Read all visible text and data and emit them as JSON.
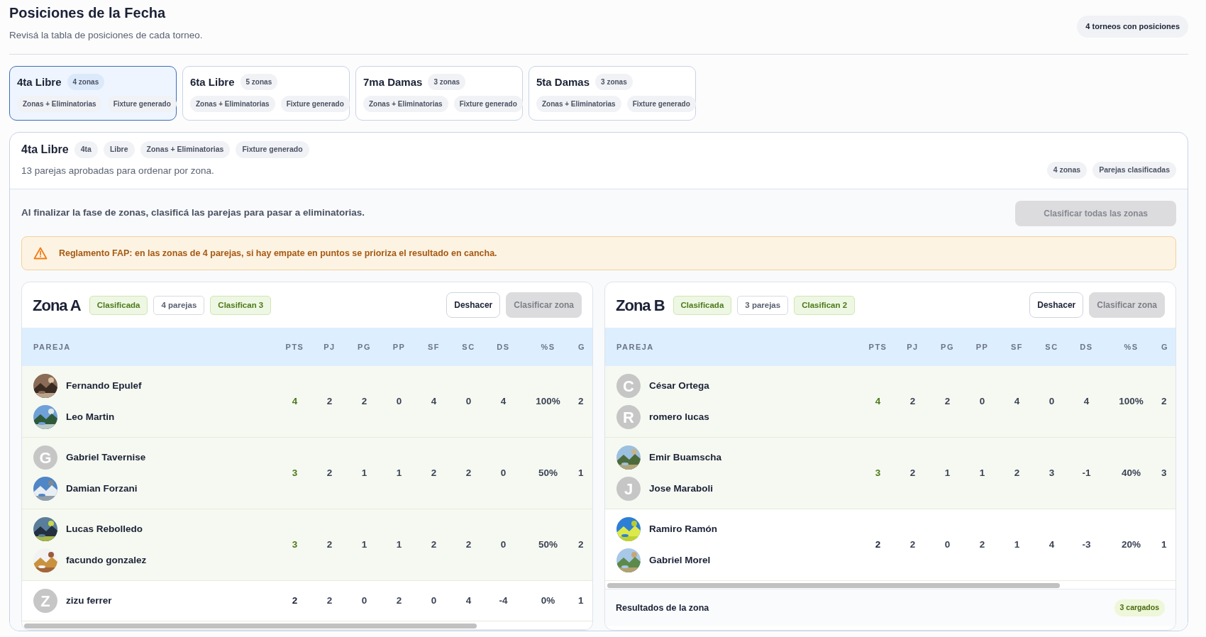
{
  "page": {
    "title": "Posiciones de la Fecha",
    "subtitle": "Revisá la tabla de posiciones de cada torneo.",
    "count_badge": "4 torneos con posiciones"
  },
  "tournaments": [
    {
      "name": "4ta Libre",
      "zones": "4 zonas",
      "tags": [
        "Zonas + Eliminatorias",
        "Fixture generado"
      ],
      "selected": true
    },
    {
      "name": "6ta Libre",
      "zones": "5 zonas",
      "tags": [
        "Zonas + Eliminatorias",
        "Fixture generado"
      ],
      "selected": false
    },
    {
      "name": "7ma Damas",
      "zones": "3 zonas",
      "tags": [
        "Zonas + Eliminatorias",
        "Fixture generado"
      ],
      "selected": false
    },
    {
      "name": "5ta Damas",
      "zones": "3 zonas",
      "tags": [
        "Zonas + Eliminatorias",
        "Fixture generado"
      ],
      "selected": false
    }
  ],
  "detail": {
    "title": "4ta Libre",
    "tags": [
      "4ta",
      "Libre",
      "Zonas + Eliminatorias",
      "Fixture generado"
    ],
    "subtitle": "13 parejas aprobadas para ordenar por zona.",
    "badges": [
      "4 zonas",
      "Parejas clasificadas"
    ],
    "instruction": "Al finalizar la fase de zonas, clasificá las parejas para pasar a eliminatorias.",
    "classify_all": {
      "label": "Clasificar todas las zonas",
      "disabled": true
    },
    "alert": "Reglamento FAP: en las zonas de 4 parejas, si hay empate en puntos se prioriza el resultado en cancha."
  },
  "zones": [
    {
      "name": "Zona A",
      "badges": [
        {
          "text": "Clasificada",
          "kind": "success"
        },
        {
          "text": "4 parejas",
          "kind": "neutral"
        },
        {
          "text": "Clasifican 3",
          "kind": "success"
        }
      ],
      "buttons": [
        {
          "label": "Deshacer",
          "disabled": false
        },
        {
          "label": "Clasificar zona",
          "disabled": true
        }
      ],
      "columns": [
        "PAREJA",
        "PTS",
        "PJ",
        "PG",
        "PP",
        "SF",
        "SC",
        "DS",
        "%S",
        "G"
      ],
      "rows": [
        {
          "qualified": true,
          "players": [
            {
              "name": "Fernando Epulef"
            },
            {
              "name": "Leo Martin"
            }
          ],
          "stats": [
            "4",
            "2",
            "2",
            "0",
            "4",
            "0",
            "4",
            "100%",
            "2"
          ]
        },
        {
          "qualified": true,
          "players": [
            {
              "name": "Gabriel Tavernise",
              "avatar": {
                "kind": "letter",
                "letter": "G"
              }
            },
            {
              "name": "Damian Forzani"
            }
          ],
          "stats": [
            "3",
            "2",
            "1",
            "1",
            "2",
            "2",
            "0",
            "50%",
            "1"
          ]
        },
        {
          "qualified": true,
          "players": [
            {
              "name": "Lucas Rebolledo"
            },
            {
              "name": "facundo gonzalez"
            }
          ],
          "stats": [
            "3",
            "2",
            "1",
            "1",
            "2",
            "2",
            "0",
            "50%",
            "2"
          ]
        },
        {
          "qualified": false,
          "players": [
            {
              "name": "zizu ferrer",
              "avatar": {
                "kind": "letter",
                "letter": "Z"
              }
            }
          ],
          "stats": [
            "2",
            "2",
            "0",
            "2",
            "0",
            "4",
            "-4",
            "0%",
            "1"
          ]
        }
      ]
    },
    {
      "name": "Zona B",
      "badges": [
        {
          "text": "Clasificada",
          "kind": "success"
        },
        {
          "text": "3 parejas",
          "kind": "neutral"
        },
        {
          "text": "Clasifican 2",
          "kind": "success"
        }
      ],
      "buttons": [
        {
          "label": "Deshacer",
          "disabled": false
        },
        {
          "label": "Clasificar zona",
          "disabled": true
        }
      ],
      "columns": [
        "PAREJA",
        "PTS",
        "PJ",
        "PG",
        "PP",
        "SF",
        "SC",
        "DS",
        "%S",
        "G"
      ],
      "rows": [
        {
          "qualified": true,
          "players": [
            {
              "name": "César Ortega",
              "avatar": {
                "kind": "letter",
                "letter": "C"
              }
            },
            {
              "name": "romero lucas",
              "avatar": {
                "kind": "letter",
                "letter": "R"
              }
            }
          ],
          "stats": [
            "4",
            "2",
            "2",
            "0",
            "4",
            "0",
            "4",
            "100%",
            "2"
          ]
        },
        {
          "qualified": true,
          "players": [
            {
              "name": "Emir Buamscha"
            },
            {
              "name": "Jose Maraboli",
              "avatar": {
                "kind": "letter",
                "letter": "J"
              }
            }
          ],
          "stats": [
            "3",
            "2",
            "1",
            "1",
            "2",
            "3",
            "-1",
            "40%",
            "3"
          ]
        },
        {
          "qualified": false,
          "players": [
            {
              "name": "Ramiro Ramón"
            },
            {
              "name": "Gabriel Morel"
            }
          ],
          "stats": [
            "2",
            "2",
            "0",
            "2",
            "1",
            "4",
            "-3",
            "20%",
            "1"
          ]
        }
      ],
      "results": {
        "title": "Resultados de la zona",
        "badge": "3 cargados"
      }
    }
  ]
}
